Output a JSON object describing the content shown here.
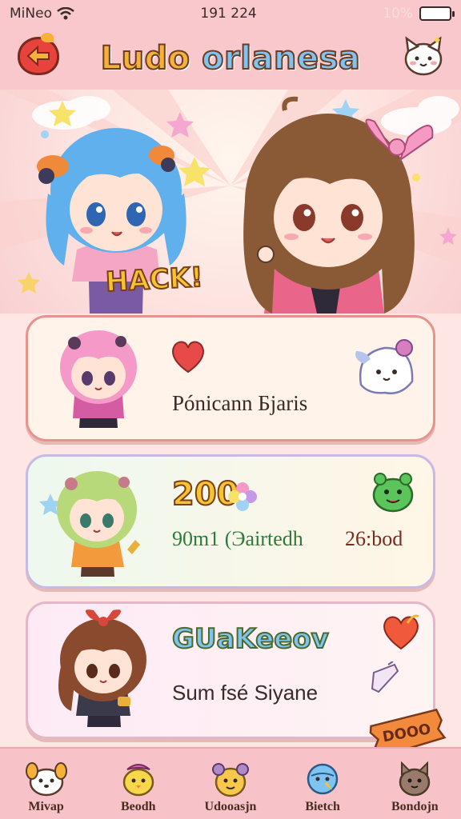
{
  "status": {
    "carrier": "MiNeo",
    "time": "191 224",
    "battery_text": "10%"
  },
  "header": {
    "title_a": "Ludo ",
    "title_b": "orlanesa"
  },
  "hero": {
    "badge": "HACK!"
  },
  "cards": [
    {
      "line1": "Pónicann Бjaris"
    },
    {
      "score": "200",
      "line1": "90m1 (Эairtedh",
      "line2": "26:bod"
    },
    {
      "heading": "GUaKeeov",
      "line1": "Sum fsé Siyane"
    }
  ],
  "ribbon": {
    "label": "DOOO"
  },
  "tabs": [
    {
      "label": "Mivap"
    },
    {
      "label": "Beodh"
    },
    {
      "label": "Udooasjn"
    },
    {
      "label": "Bietch"
    },
    {
      "label": "Bondojn"
    }
  ],
  "colors": {
    "bg": "#fde6e4",
    "bar": "#f8c8cc",
    "title": "#f6b13a",
    "accent": "#7fc4f0"
  }
}
